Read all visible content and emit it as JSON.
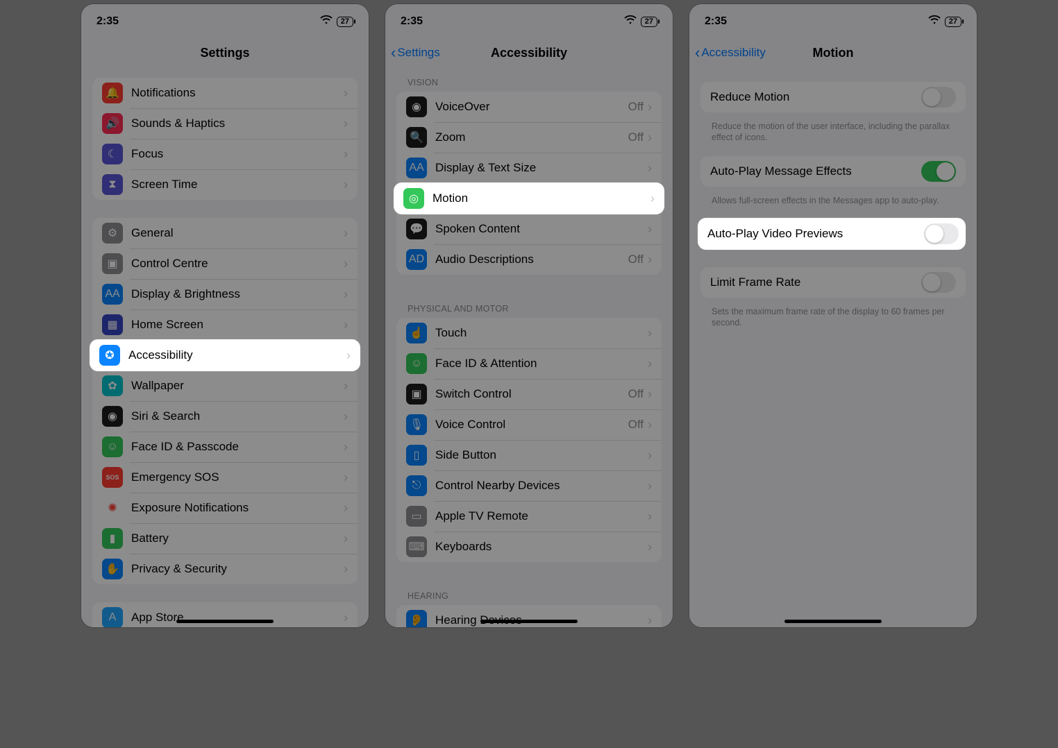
{
  "status": {
    "time": "2:35",
    "battery": "27"
  },
  "screen1": {
    "title": "Settings",
    "group1": [
      {
        "label": "Notifications",
        "icon_bg": "#ff3b30",
        "glyph": "🔔"
      },
      {
        "label": "Sounds & Haptics",
        "icon_bg": "#ff2d55",
        "glyph": "🔊"
      },
      {
        "label": "Focus",
        "icon_bg": "#5856d6",
        "glyph": "☾"
      },
      {
        "label": "Screen Time",
        "icon_bg": "#5856d6",
        "glyph": "⧗"
      }
    ],
    "group2": [
      {
        "label": "General",
        "icon_bg": "#8e8e93",
        "glyph": "⚙"
      },
      {
        "label": "Control Centre",
        "icon_bg": "#8e8e93",
        "glyph": "▣"
      },
      {
        "label": "Display & Brightness",
        "icon_bg": "#0a84ff",
        "glyph": "AA"
      },
      {
        "label": "Home Screen",
        "icon_bg": "#3544c4",
        "glyph": "▦"
      },
      {
        "label": "Accessibility",
        "icon_bg": "#0a84ff",
        "glyph": "✪"
      },
      {
        "label": "Wallpaper",
        "icon_bg": "#00c3cc",
        "glyph": "✿"
      },
      {
        "label": "Siri & Search",
        "icon_bg": "#1c1c1e",
        "glyph": "◉"
      },
      {
        "label": "Face ID & Passcode",
        "icon_bg": "#34c759",
        "glyph": "☺"
      },
      {
        "label": "Emergency SOS",
        "icon_bg": "#ff3b30",
        "glyph": "SOS"
      },
      {
        "label": "Exposure Notifications",
        "icon_bg": "#ffffff",
        "glyph": "✺",
        "fg": "#ff3b30"
      },
      {
        "label": "Battery",
        "icon_bg": "#34c759",
        "glyph": "▮"
      },
      {
        "label": "Privacy & Security",
        "icon_bg": "#0a84ff",
        "glyph": "✋"
      }
    ],
    "group3": [
      {
        "label": "App Store",
        "icon_bg": "#1fa7ff",
        "glyph": "A"
      }
    ],
    "highlight_index": 4
  },
  "screen2": {
    "back": "Settings",
    "title": "Accessibility",
    "section_vision": "VISION",
    "vision": [
      {
        "label": "VoiceOver",
        "icon_bg": "#1c1c1e",
        "glyph": "◉",
        "value": "Off"
      },
      {
        "label": "Zoom",
        "icon_bg": "#1c1c1e",
        "glyph": "🔍",
        "value": "Off"
      },
      {
        "label": "Display & Text Size",
        "icon_bg": "#0a84ff",
        "glyph": "AA"
      },
      {
        "label": "Motion",
        "icon_bg": "#34c759",
        "glyph": "◎"
      },
      {
        "label": "Spoken Content",
        "icon_bg": "#1c1c1e",
        "glyph": "💬"
      },
      {
        "label": "Audio Descriptions",
        "icon_bg": "#0a84ff",
        "glyph": "AD",
        "value": "Off"
      }
    ],
    "section_motor": "PHYSICAL AND MOTOR",
    "motor": [
      {
        "label": "Touch",
        "icon_bg": "#0a84ff",
        "glyph": "☝"
      },
      {
        "label": "Face ID & Attention",
        "icon_bg": "#34c759",
        "glyph": "☺"
      },
      {
        "label": "Switch Control",
        "icon_bg": "#1c1c1e",
        "glyph": "▣",
        "value": "Off"
      },
      {
        "label": "Voice Control",
        "icon_bg": "#0a84ff",
        "glyph": "🎙",
        "value": "Off"
      },
      {
        "label": "Side Button",
        "icon_bg": "#0a84ff",
        "glyph": "▯"
      },
      {
        "label": "Control Nearby Devices",
        "icon_bg": "#0a84ff",
        "glyph": "⎋"
      },
      {
        "label": "Apple TV Remote",
        "icon_bg": "#8e8e93",
        "glyph": "▭"
      },
      {
        "label": "Keyboards",
        "icon_bg": "#8e8e93",
        "glyph": "⌨"
      }
    ],
    "section_hearing": "HEARING",
    "hearing": [
      {
        "label": "Hearing Devices",
        "icon_bg": "#0a84ff",
        "glyph": "👂"
      }
    ],
    "highlight_index": 3
  },
  "screen3": {
    "back": "Accessibility",
    "title": "Motion",
    "rows": [
      {
        "label": "Reduce Motion",
        "type": "toggle",
        "on": false,
        "footer": "Reduce the motion of the user interface, including the parallax effect of icons."
      },
      {
        "label": "Auto-Play Message Effects",
        "type": "toggle",
        "on": true,
        "footer": "Allows full-screen effects in the Messages app to auto-play."
      },
      {
        "label": "Auto-Play Video Previews",
        "type": "toggle",
        "on": false
      },
      {
        "label": "Limit Frame Rate",
        "type": "toggle",
        "on": false,
        "footer": "Sets the maximum frame rate of the display to 60 frames per second."
      }
    ],
    "highlight_index": 2
  }
}
